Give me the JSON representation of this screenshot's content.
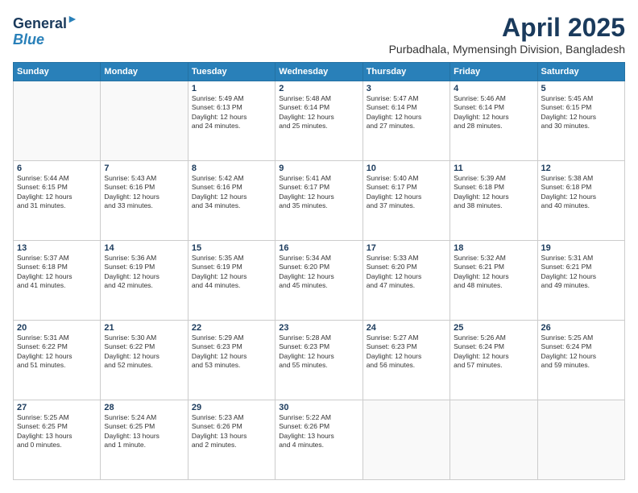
{
  "logo": {
    "line1": "General",
    "line2": "Blue"
  },
  "title": "April 2025",
  "location": "Purbadhala, Mymensingh Division, Bangladesh",
  "weekdays": [
    "Sunday",
    "Monday",
    "Tuesday",
    "Wednesday",
    "Thursday",
    "Friday",
    "Saturday"
  ],
  "weeks": [
    [
      {
        "num": "",
        "info": ""
      },
      {
        "num": "",
        "info": ""
      },
      {
        "num": "1",
        "info": "Sunrise: 5:49 AM\nSunset: 6:13 PM\nDaylight: 12 hours\nand 24 minutes."
      },
      {
        "num": "2",
        "info": "Sunrise: 5:48 AM\nSunset: 6:14 PM\nDaylight: 12 hours\nand 25 minutes."
      },
      {
        "num": "3",
        "info": "Sunrise: 5:47 AM\nSunset: 6:14 PM\nDaylight: 12 hours\nand 27 minutes."
      },
      {
        "num": "4",
        "info": "Sunrise: 5:46 AM\nSunset: 6:14 PM\nDaylight: 12 hours\nand 28 minutes."
      },
      {
        "num": "5",
        "info": "Sunrise: 5:45 AM\nSunset: 6:15 PM\nDaylight: 12 hours\nand 30 minutes."
      }
    ],
    [
      {
        "num": "6",
        "info": "Sunrise: 5:44 AM\nSunset: 6:15 PM\nDaylight: 12 hours\nand 31 minutes."
      },
      {
        "num": "7",
        "info": "Sunrise: 5:43 AM\nSunset: 6:16 PM\nDaylight: 12 hours\nand 33 minutes."
      },
      {
        "num": "8",
        "info": "Sunrise: 5:42 AM\nSunset: 6:16 PM\nDaylight: 12 hours\nand 34 minutes."
      },
      {
        "num": "9",
        "info": "Sunrise: 5:41 AM\nSunset: 6:17 PM\nDaylight: 12 hours\nand 35 minutes."
      },
      {
        "num": "10",
        "info": "Sunrise: 5:40 AM\nSunset: 6:17 PM\nDaylight: 12 hours\nand 37 minutes."
      },
      {
        "num": "11",
        "info": "Sunrise: 5:39 AM\nSunset: 6:18 PM\nDaylight: 12 hours\nand 38 minutes."
      },
      {
        "num": "12",
        "info": "Sunrise: 5:38 AM\nSunset: 6:18 PM\nDaylight: 12 hours\nand 40 minutes."
      }
    ],
    [
      {
        "num": "13",
        "info": "Sunrise: 5:37 AM\nSunset: 6:18 PM\nDaylight: 12 hours\nand 41 minutes."
      },
      {
        "num": "14",
        "info": "Sunrise: 5:36 AM\nSunset: 6:19 PM\nDaylight: 12 hours\nand 42 minutes."
      },
      {
        "num": "15",
        "info": "Sunrise: 5:35 AM\nSunset: 6:19 PM\nDaylight: 12 hours\nand 44 minutes."
      },
      {
        "num": "16",
        "info": "Sunrise: 5:34 AM\nSunset: 6:20 PM\nDaylight: 12 hours\nand 45 minutes."
      },
      {
        "num": "17",
        "info": "Sunrise: 5:33 AM\nSunset: 6:20 PM\nDaylight: 12 hours\nand 47 minutes."
      },
      {
        "num": "18",
        "info": "Sunrise: 5:32 AM\nSunset: 6:21 PM\nDaylight: 12 hours\nand 48 minutes."
      },
      {
        "num": "19",
        "info": "Sunrise: 5:31 AM\nSunset: 6:21 PM\nDaylight: 12 hours\nand 49 minutes."
      }
    ],
    [
      {
        "num": "20",
        "info": "Sunrise: 5:31 AM\nSunset: 6:22 PM\nDaylight: 12 hours\nand 51 minutes."
      },
      {
        "num": "21",
        "info": "Sunrise: 5:30 AM\nSunset: 6:22 PM\nDaylight: 12 hours\nand 52 minutes."
      },
      {
        "num": "22",
        "info": "Sunrise: 5:29 AM\nSunset: 6:23 PM\nDaylight: 12 hours\nand 53 minutes."
      },
      {
        "num": "23",
        "info": "Sunrise: 5:28 AM\nSunset: 6:23 PM\nDaylight: 12 hours\nand 55 minutes."
      },
      {
        "num": "24",
        "info": "Sunrise: 5:27 AM\nSunset: 6:23 PM\nDaylight: 12 hours\nand 56 minutes."
      },
      {
        "num": "25",
        "info": "Sunrise: 5:26 AM\nSunset: 6:24 PM\nDaylight: 12 hours\nand 57 minutes."
      },
      {
        "num": "26",
        "info": "Sunrise: 5:25 AM\nSunset: 6:24 PM\nDaylight: 12 hours\nand 59 minutes."
      }
    ],
    [
      {
        "num": "27",
        "info": "Sunrise: 5:25 AM\nSunset: 6:25 PM\nDaylight: 13 hours\nand 0 minutes."
      },
      {
        "num": "28",
        "info": "Sunrise: 5:24 AM\nSunset: 6:25 PM\nDaylight: 13 hours\nand 1 minute."
      },
      {
        "num": "29",
        "info": "Sunrise: 5:23 AM\nSunset: 6:26 PM\nDaylight: 13 hours\nand 2 minutes."
      },
      {
        "num": "30",
        "info": "Sunrise: 5:22 AM\nSunset: 6:26 PM\nDaylight: 13 hours\nand 4 minutes."
      },
      {
        "num": "",
        "info": ""
      },
      {
        "num": "",
        "info": ""
      },
      {
        "num": "",
        "info": ""
      }
    ]
  ]
}
